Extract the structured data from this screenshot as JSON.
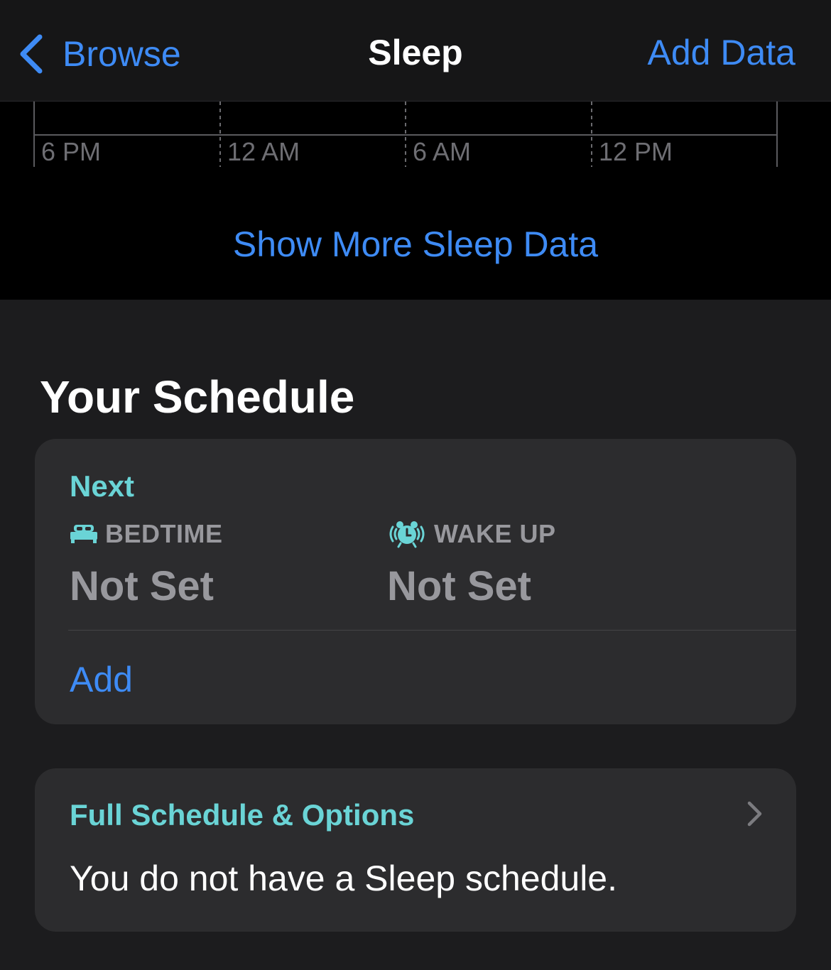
{
  "nav": {
    "back_label": "Browse",
    "title": "Sleep",
    "action_label": "Add Data"
  },
  "chart": {
    "axis_labels": [
      "6 PM",
      "12 AM",
      "6 AM",
      "12 PM"
    ],
    "show_more_label": "Show More Sleep Data"
  },
  "schedule": {
    "section_title": "Your Schedule",
    "next_card": {
      "heading": "Next",
      "bedtime_label": "BEDTIME",
      "bedtime_value": "Not Set",
      "wake_label": "WAKE UP",
      "wake_value": "Not Set",
      "add_label": "Add"
    },
    "full_card": {
      "heading": "Full Schedule & Options",
      "body": "You do not have a Sleep schedule."
    }
  },
  "icons": {
    "back": "chevron-left-icon",
    "bedtime": "bed-icon",
    "wake": "alarm-clock-icon",
    "disclosure": "chevron-right-icon"
  },
  "colors": {
    "accent_blue": "#3e8bf5",
    "accent_teal": "#6ad4d6",
    "secondary_text": "#98989d",
    "card_bg": "#2c2c2e",
    "page_bg": "#1c1c1e"
  }
}
